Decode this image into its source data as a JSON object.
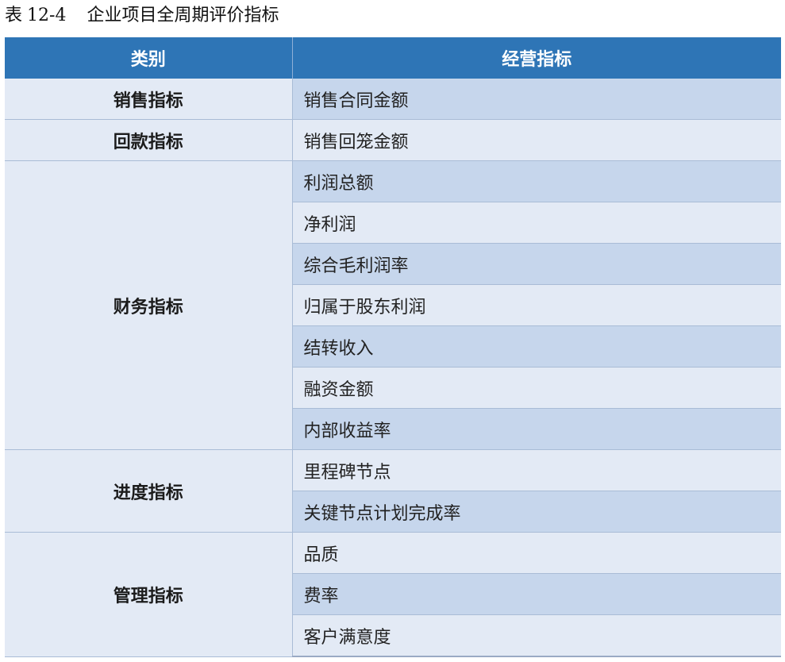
{
  "caption": {
    "prefix": "表",
    "number": "12-4",
    "title": "企业项目全周期评价指标"
  },
  "table": {
    "headers": [
      "类别",
      "经营指标"
    ],
    "groups": [
      {
        "category": "销售指标",
        "items": [
          "销售合同金额"
        ]
      },
      {
        "category": "回款指标",
        "items": [
          "销售回笼金额"
        ]
      },
      {
        "category": "财务指标",
        "items": [
          "利润总额",
          "净利润",
          "综合毛利润率",
          "归属于股东利润",
          "结转收入",
          "融资金额",
          "内部收益率"
        ]
      },
      {
        "category": "进度指标",
        "items": [
          "里程碑节点",
          "关键节点计划完成率"
        ]
      },
      {
        "category": "管理指标",
        "items": [
          "品质",
          "费率",
          "客户满意度"
        ]
      }
    ]
  },
  "colors": {
    "header_bg": "#2e75b6",
    "row_dark": "#c6d6ec",
    "row_light": "#e3eaf5"
  }
}
